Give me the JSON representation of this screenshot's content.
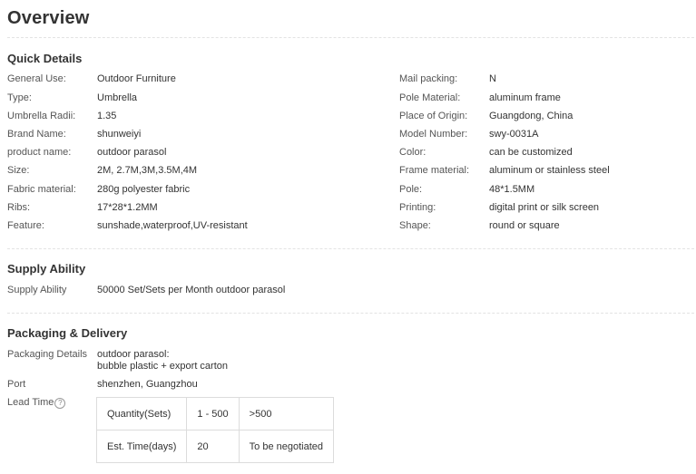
{
  "title": "Overview",
  "quick_details": {
    "heading": "Quick Details",
    "left": [
      {
        "label": "General Use:",
        "value": "Outdoor Furniture"
      },
      {
        "label": "Type:",
        "value": "Umbrella"
      },
      {
        "label": "Umbrella Radii:",
        "value": "1.35"
      },
      {
        "label": "Brand Name:",
        "value": "shunweiyi"
      },
      {
        "label": "product name:",
        "value": "outdoor parasol"
      },
      {
        "label": "Size:",
        "value": "2M, 2.7M,3M,3.5M,4M"
      },
      {
        "label": "Fabric material:",
        "value": "280g polyester fabric"
      },
      {
        "label": "Ribs:",
        "value": "17*28*1.2MM"
      },
      {
        "label": "Feature:",
        "value": "sunshade,waterproof,UV-resistant"
      }
    ],
    "right": [
      {
        "label": "Mail packing:",
        "value": "N"
      },
      {
        "label": "Pole Material:",
        "value": "aluminum frame"
      },
      {
        "label": "Place of Origin:",
        "value": "Guangdong, China"
      },
      {
        "label": "Model Number:",
        "value": "swy-0031A"
      },
      {
        "label": "Color:",
        "value": "can be customized"
      },
      {
        "label": "Frame material:",
        "value": "aluminum or stainless steel"
      },
      {
        "label": "Pole:",
        "value": "48*1.5MM"
      },
      {
        "label": "Printing:",
        "value": "digital print or silk screen"
      },
      {
        "label": "Shape:",
        "value": "round or square"
      }
    ]
  },
  "supply_ability": {
    "heading": "Supply Ability",
    "label": "Supply Ability",
    "value": "50000 Set/Sets per Month outdoor parasol"
  },
  "packaging": {
    "heading": "Packaging & Delivery",
    "details_label": "Packaging Details",
    "details_line1": "outdoor parasol:",
    "details_line2": "bubble plastic + export carton",
    "port_label": "Port",
    "port_value": "shenzhen, Guangzhou",
    "lead_time_label": "Lead Time",
    "help_icon_glyph": "?",
    "lead_table": {
      "row1": [
        "Quantity(Sets)",
        "1 - 500",
        ">500"
      ],
      "row2": [
        "Est. Time(days)",
        "20",
        "To be negotiated"
      ]
    }
  }
}
